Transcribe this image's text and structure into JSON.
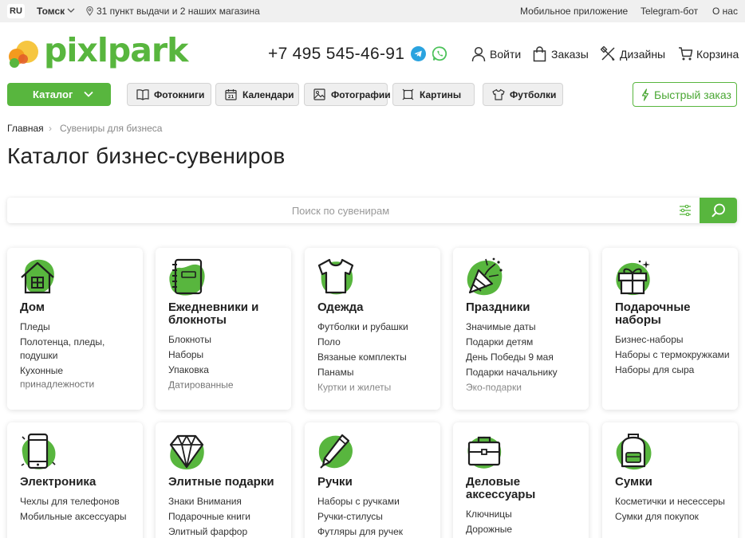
{
  "topbar": {
    "lang": "RU",
    "city": "Томск",
    "pickup": "31 пункт выдачи и 2 наших магазина",
    "links": [
      "Мобильное приложение",
      "Telegram-бот",
      "О нас"
    ]
  },
  "header": {
    "logo_text": "pixlpark",
    "phone": "+7 495 545-46-91",
    "nav": {
      "login": "Войти",
      "orders": "Заказы",
      "designs": "Дизайны",
      "cart": "Корзина"
    }
  },
  "catalog_row": {
    "catalog_label": "Каталог",
    "categories": [
      "Фотокниги",
      "Календари",
      "Фотографии",
      "Картины",
      "Футболки"
    ],
    "quick_order": "Быстрый заказ"
  },
  "breadcrumb": {
    "home": "Главная",
    "separator": "›",
    "current": "Сувениры для бизнеса"
  },
  "page_title": "Каталог бизнес-сувениров",
  "search": {
    "placeholder": "Поиск по сувенирам",
    "value": ""
  },
  "cards": [
    {
      "title": "Дом",
      "icon": "house-icon",
      "items": [
        "Пледы",
        "Полотенца, пледы, подушки",
        "Кухонные принадлежности"
      ]
    },
    {
      "title": "Ежедневники и блокноты",
      "icon": "notebook-icon",
      "items": [
        "Блокноты",
        "Наборы",
        "Упаковка",
        "Датированные"
      ]
    },
    {
      "title": "Одежда",
      "icon": "tshirt-icon",
      "items": [
        "Футболки и рубашки",
        "Поло",
        "Вязаные комплекты",
        "Панамы",
        "Куртки и жилеты"
      ]
    },
    {
      "title": "Праздники",
      "icon": "party-popper-icon",
      "items": [
        "Значимые даты",
        "Подарки детям",
        "День Победы 9 мая",
        "Подарки начальнику",
        "Эко-подарки"
      ]
    },
    {
      "title": "Подарочные наборы",
      "icon": "gift-icon",
      "items": [
        "Бизнес-наборы",
        "Наборы с термокружками",
        "Наборы для сыра"
      ]
    },
    {
      "title": "Электроника",
      "icon": "smartphone-icon",
      "items": [
        "Чехлы для телефонов",
        "Мобильные аксессуары"
      ]
    },
    {
      "title": "Элитные подарки",
      "icon": "diamond-icon",
      "items": [
        "Знаки Внимания",
        "Подарочные книги",
        "Элитный фарфор"
      ]
    },
    {
      "title": "Ручки",
      "icon": "pen-icon",
      "items": [
        "Наборы с ручками",
        "Ручки-стилусы",
        "Футляры для ручек"
      ]
    },
    {
      "title": "Деловые аксессуары",
      "icon": "briefcase-icon",
      "items": [
        "Ключницы",
        "Дорожные"
      ]
    },
    {
      "title": "Сумки",
      "icon": "backpack-icon",
      "items": [
        "Косметички и несессеры",
        "Сумки для покупок"
      ]
    }
  ],
  "colors": {
    "brand_green": "#58b63e",
    "topbar_bg": "#f0f0f0",
    "pill_bg": "#efefef",
    "telegram_blue": "#2aa3df",
    "whatsapp_green": "#4cc25a",
    "logo_orange": "#f39a1e",
    "logo_yellow": "#f6c640"
  }
}
